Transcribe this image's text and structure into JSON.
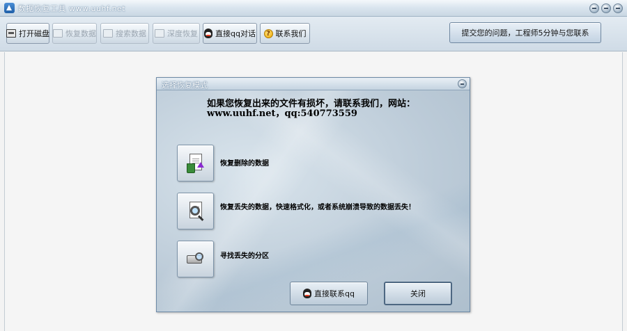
{
  "window": {
    "title": "数据恢复工具 www.uuhf.net"
  },
  "toolbar": {
    "buttons": [
      {
        "label": "打开磁盘",
        "icon": "disk-icon",
        "enabled": true
      },
      {
        "label": "恢复数据",
        "icon": "restore-icon",
        "enabled": false
      },
      {
        "label": "搜索数据",
        "icon": "search-data-icon",
        "enabled": false
      },
      {
        "label": "深度恢复",
        "icon": "deep-restore-icon",
        "enabled": false
      },
      {
        "label": "直接qq对话",
        "icon": "qq-icon",
        "enabled": true
      },
      {
        "label": "联系我们",
        "icon": "help-icon",
        "enabled": true
      }
    ],
    "submit_label": "提交您的问题，工程师5分钟与您联系"
  },
  "dialog": {
    "title": "选择恢复模式",
    "notice": "如果您恢复出来的文件有损坏，请联系我们，网站：www.uuhf.net，qq:540773559",
    "options": [
      {
        "label": "恢复删除的数据",
        "icon": "recycle-document-icon"
      },
      {
        "label": "恢复丢失的数据，快速格式化，或者系统崩溃导致的数据丢失！",
        "icon": "magnifier-document-icon"
      },
      {
        "label": "寻找丢失的分区",
        "icon": "drive-search-icon"
      }
    ],
    "qq_button_label": "直接联系qq",
    "close_button_label": "关闭"
  },
  "colors": {
    "titlebar": "#c9d7e3",
    "dialog_background": "#bccbd8",
    "app_background": "#f5f5f5"
  }
}
